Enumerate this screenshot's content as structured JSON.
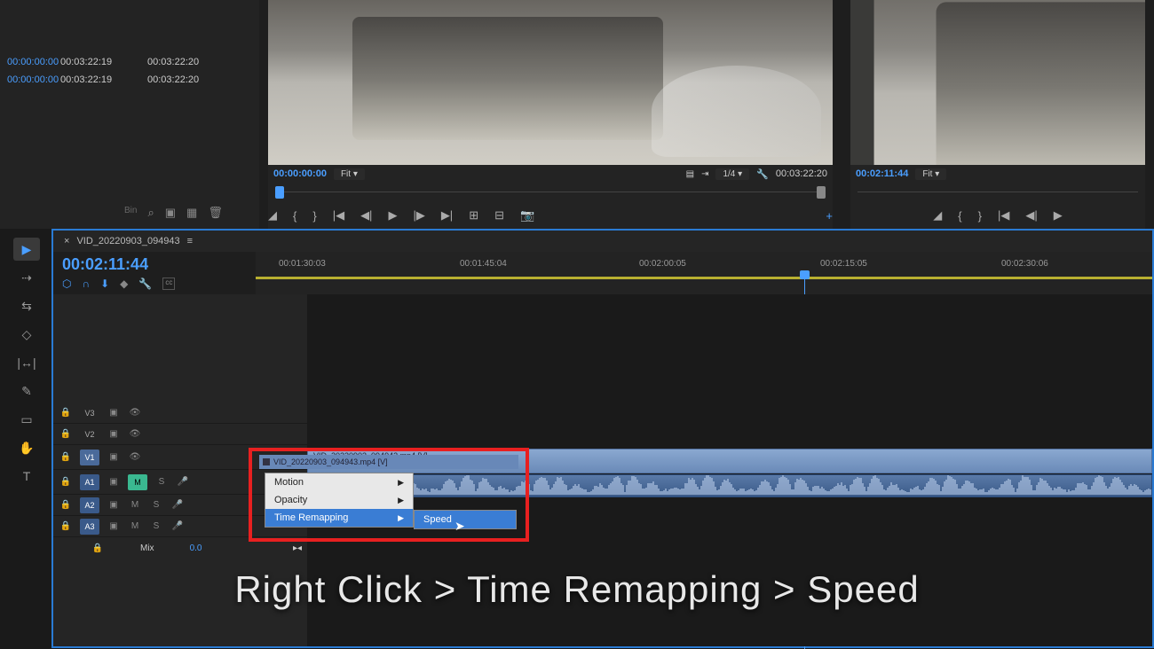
{
  "left_panel": {
    "rows": [
      {
        "c0": "00:00:00:00",
        "c1": "00:03:22:19",
        "c2": "00:03:22:20"
      },
      {
        "c0": "00:00:00:00",
        "c1": "00:03:22:19",
        "c2": "00:03:22:20"
      }
    ],
    "bins_label": "Bin"
  },
  "source": {
    "in_tc": "00:00:00:00",
    "fit": "Fit",
    "scale": "1/4",
    "out_tc": "00:03:22:20"
  },
  "program": {
    "tc": "00:02:11:44",
    "fit": "Fit"
  },
  "timeline": {
    "tab": "VID_20220903_094943",
    "playhead_tc": "00:02:11:44",
    "ruler": [
      "00:01:30:03",
      "00:01:45:04",
      "00:02:00:05",
      "00:02:15:05",
      "00:02:30:06"
    ],
    "tracks_v": [
      "V3",
      "V2",
      "V1"
    ],
    "tracks_a": [
      "A1",
      "A2",
      "A3"
    ],
    "mix_label": "Mix",
    "mix_val": "0.0",
    "clip_name": "VID_20220903_094943.mp4 [V]"
  },
  "context_menu": {
    "clip_header": "VID_20220903_094943.mp4 [V]",
    "items": [
      "Motion",
      "Opacity",
      "Time Remapping"
    ],
    "sub_item": "Speed"
  },
  "caption": "Right Click > Time Remapping > Speed"
}
